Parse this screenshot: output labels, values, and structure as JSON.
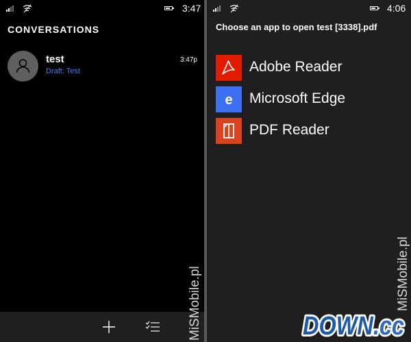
{
  "left_phone": {
    "status": {
      "time": "3:47"
    },
    "title": "CONVERSATIONS",
    "conversations": [
      {
        "name": "test",
        "preview": "Draft: Test",
        "time": "3:47p"
      }
    ],
    "appbar": {
      "new_icon": "plus-icon",
      "select_icon": "select-list-icon"
    },
    "watermark": "MiSMobile.pl"
  },
  "right_phone": {
    "status": {
      "time": "4:06"
    },
    "title": "Choose an app to open test [3338].pdf",
    "apps": [
      {
        "label": "Adobe Reader",
        "icon": "adobe-reader-icon",
        "color": "#e21c00"
      },
      {
        "label": "Microsoft Edge",
        "icon": "edge-icon",
        "color": "#3f6ff2"
      },
      {
        "label": "PDF Reader",
        "icon": "pdf-reader-icon",
        "color": "#d9441f"
      }
    ],
    "watermark": "MiSMobile.pl"
  },
  "logo": {
    "text": "DOWN.cc",
    "main": "DOWN",
    "suffix": ".cc",
    "color": "#1e5aa6"
  }
}
